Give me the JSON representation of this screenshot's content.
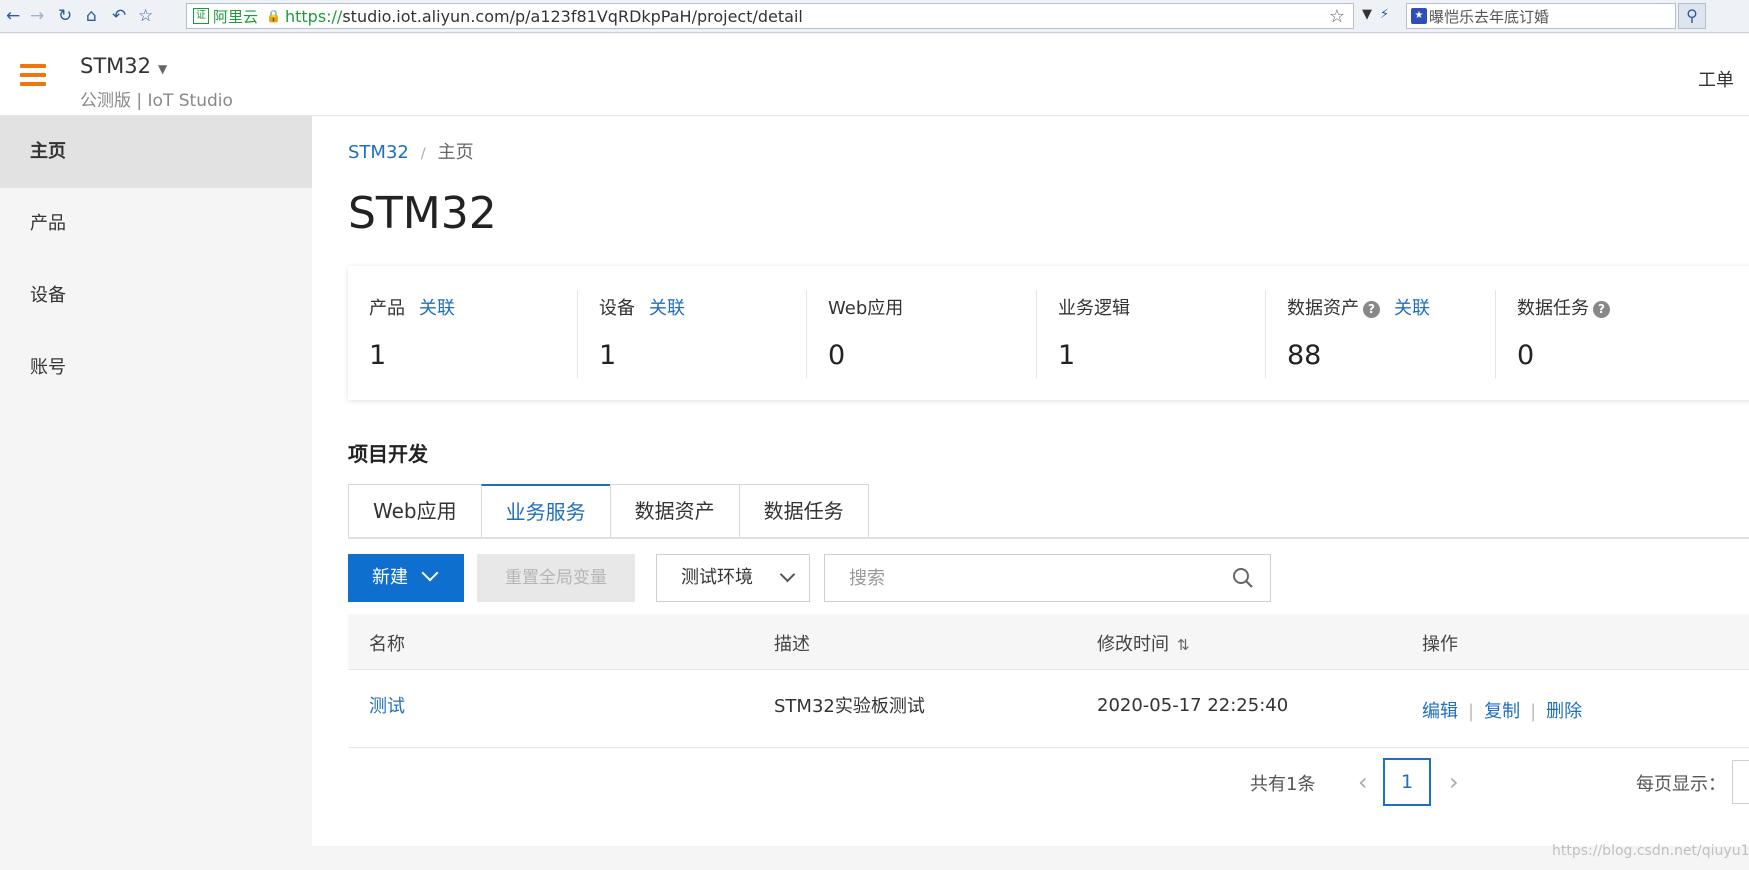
{
  "browser": {
    "site_name": "阿里云",
    "cert_badge": "证",
    "url_scheme": "https://",
    "url_rest": "studio.iot.aliyun.com/p/a123f81VqRDkpPaH/project/detail",
    "search_text": "曝恺乐去年底订婚"
  },
  "header": {
    "project_name": "STM32",
    "subtitle": "公测版 | IoT Studio",
    "tickets_label": "工单"
  },
  "sidebar": {
    "items": [
      {
        "label": "主页",
        "active": true
      },
      {
        "label": "产品",
        "active": false
      },
      {
        "label": "设备",
        "active": false
      },
      {
        "label": "账号",
        "active": false
      }
    ]
  },
  "breadcrumb": {
    "project": "STM32",
    "separator": "/",
    "current": "主页"
  },
  "page_title": "STM32",
  "stats": [
    {
      "label": "产品",
      "link": "关联",
      "value": "1"
    },
    {
      "label": "设备",
      "link": "关联",
      "value": "1"
    },
    {
      "label": "Web应用",
      "link": "",
      "value": "0"
    },
    {
      "label": "业务逻辑",
      "link": "",
      "value": "1"
    },
    {
      "label": "数据资产",
      "link": "关联",
      "help": "?",
      "value": "88"
    },
    {
      "label": "数据任务",
      "link": "",
      "help": "?",
      "value": "0"
    }
  ],
  "section_title": "项目开发",
  "tabs": [
    {
      "label": "Web应用",
      "active": false
    },
    {
      "label": "业务服务",
      "active": true
    },
    {
      "label": "数据资产",
      "active": false
    },
    {
      "label": "数据任务",
      "active": false
    }
  ],
  "toolbar": {
    "new_label": "新建",
    "reset_label": "重置全局变量",
    "env_label": "测试环境",
    "search_placeholder": "搜索"
  },
  "table": {
    "headers": {
      "name": "名称",
      "desc": "描述",
      "modified": "修改时间",
      "ops": "操作"
    },
    "rows": [
      {
        "name": "测试",
        "desc": "STM32实验板测试",
        "modified": "2020-05-17 22:25:40",
        "ops": [
          "编辑",
          "复制",
          "删除"
        ]
      }
    ]
  },
  "pagination": {
    "total": "共有1条",
    "current_page": "1",
    "page_size_label": "每页显示："
  },
  "watermark": "https://blog.csdn.net/qiuyu1"
}
